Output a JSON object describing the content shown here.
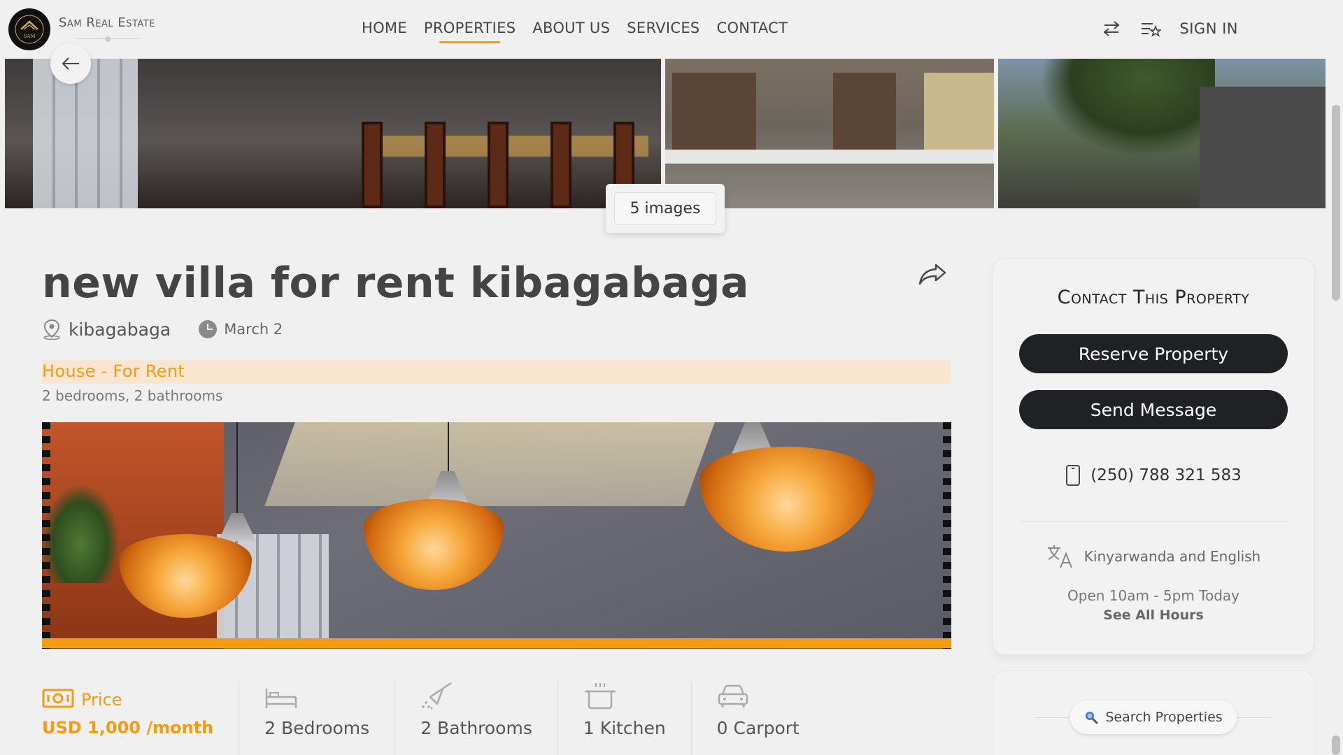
{
  "header": {
    "brand": "Sam Real Estate",
    "logo_text": "SAM",
    "nav": [
      "HOME",
      "PROPERTIES",
      "ABOUT US",
      "SERVICES",
      "CONTACT"
    ],
    "active_nav": "PROPERTIES",
    "sign_in": "SIGN IN",
    "icons": [
      "compare-arrows-icon",
      "favorites-list-icon"
    ]
  },
  "gallery": {
    "count_label": "5 images",
    "back_icon": "arrow-left-icon"
  },
  "property": {
    "title": "new villa for rent kibagabaga",
    "location": "kibagabaga",
    "date": "March 2",
    "type": "House - For Rent",
    "summary": "2 bedrooms, 2 bathrooms"
  },
  "features": {
    "price_label": "Price",
    "price_value": "USD 1,000 /month",
    "items": [
      "2 Bedrooms",
      "2 Bathrooms",
      "1 Kitchen",
      "0 Carport"
    ]
  },
  "contact": {
    "title": "Contact This Property",
    "reserve_button": "Reserve Property",
    "message_button": "Send Message",
    "phone": "(250) 788 321 583",
    "languages": "Kinyarwanda and English",
    "hours": "Open 10am - 5pm Today",
    "see_hours": "See All Hours"
  },
  "search": {
    "label": "Search Properties"
  },
  "colors": {
    "accent": "#f39c12",
    "button_dark": "#1f2124",
    "background": "#f0f0f0"
  }
}
